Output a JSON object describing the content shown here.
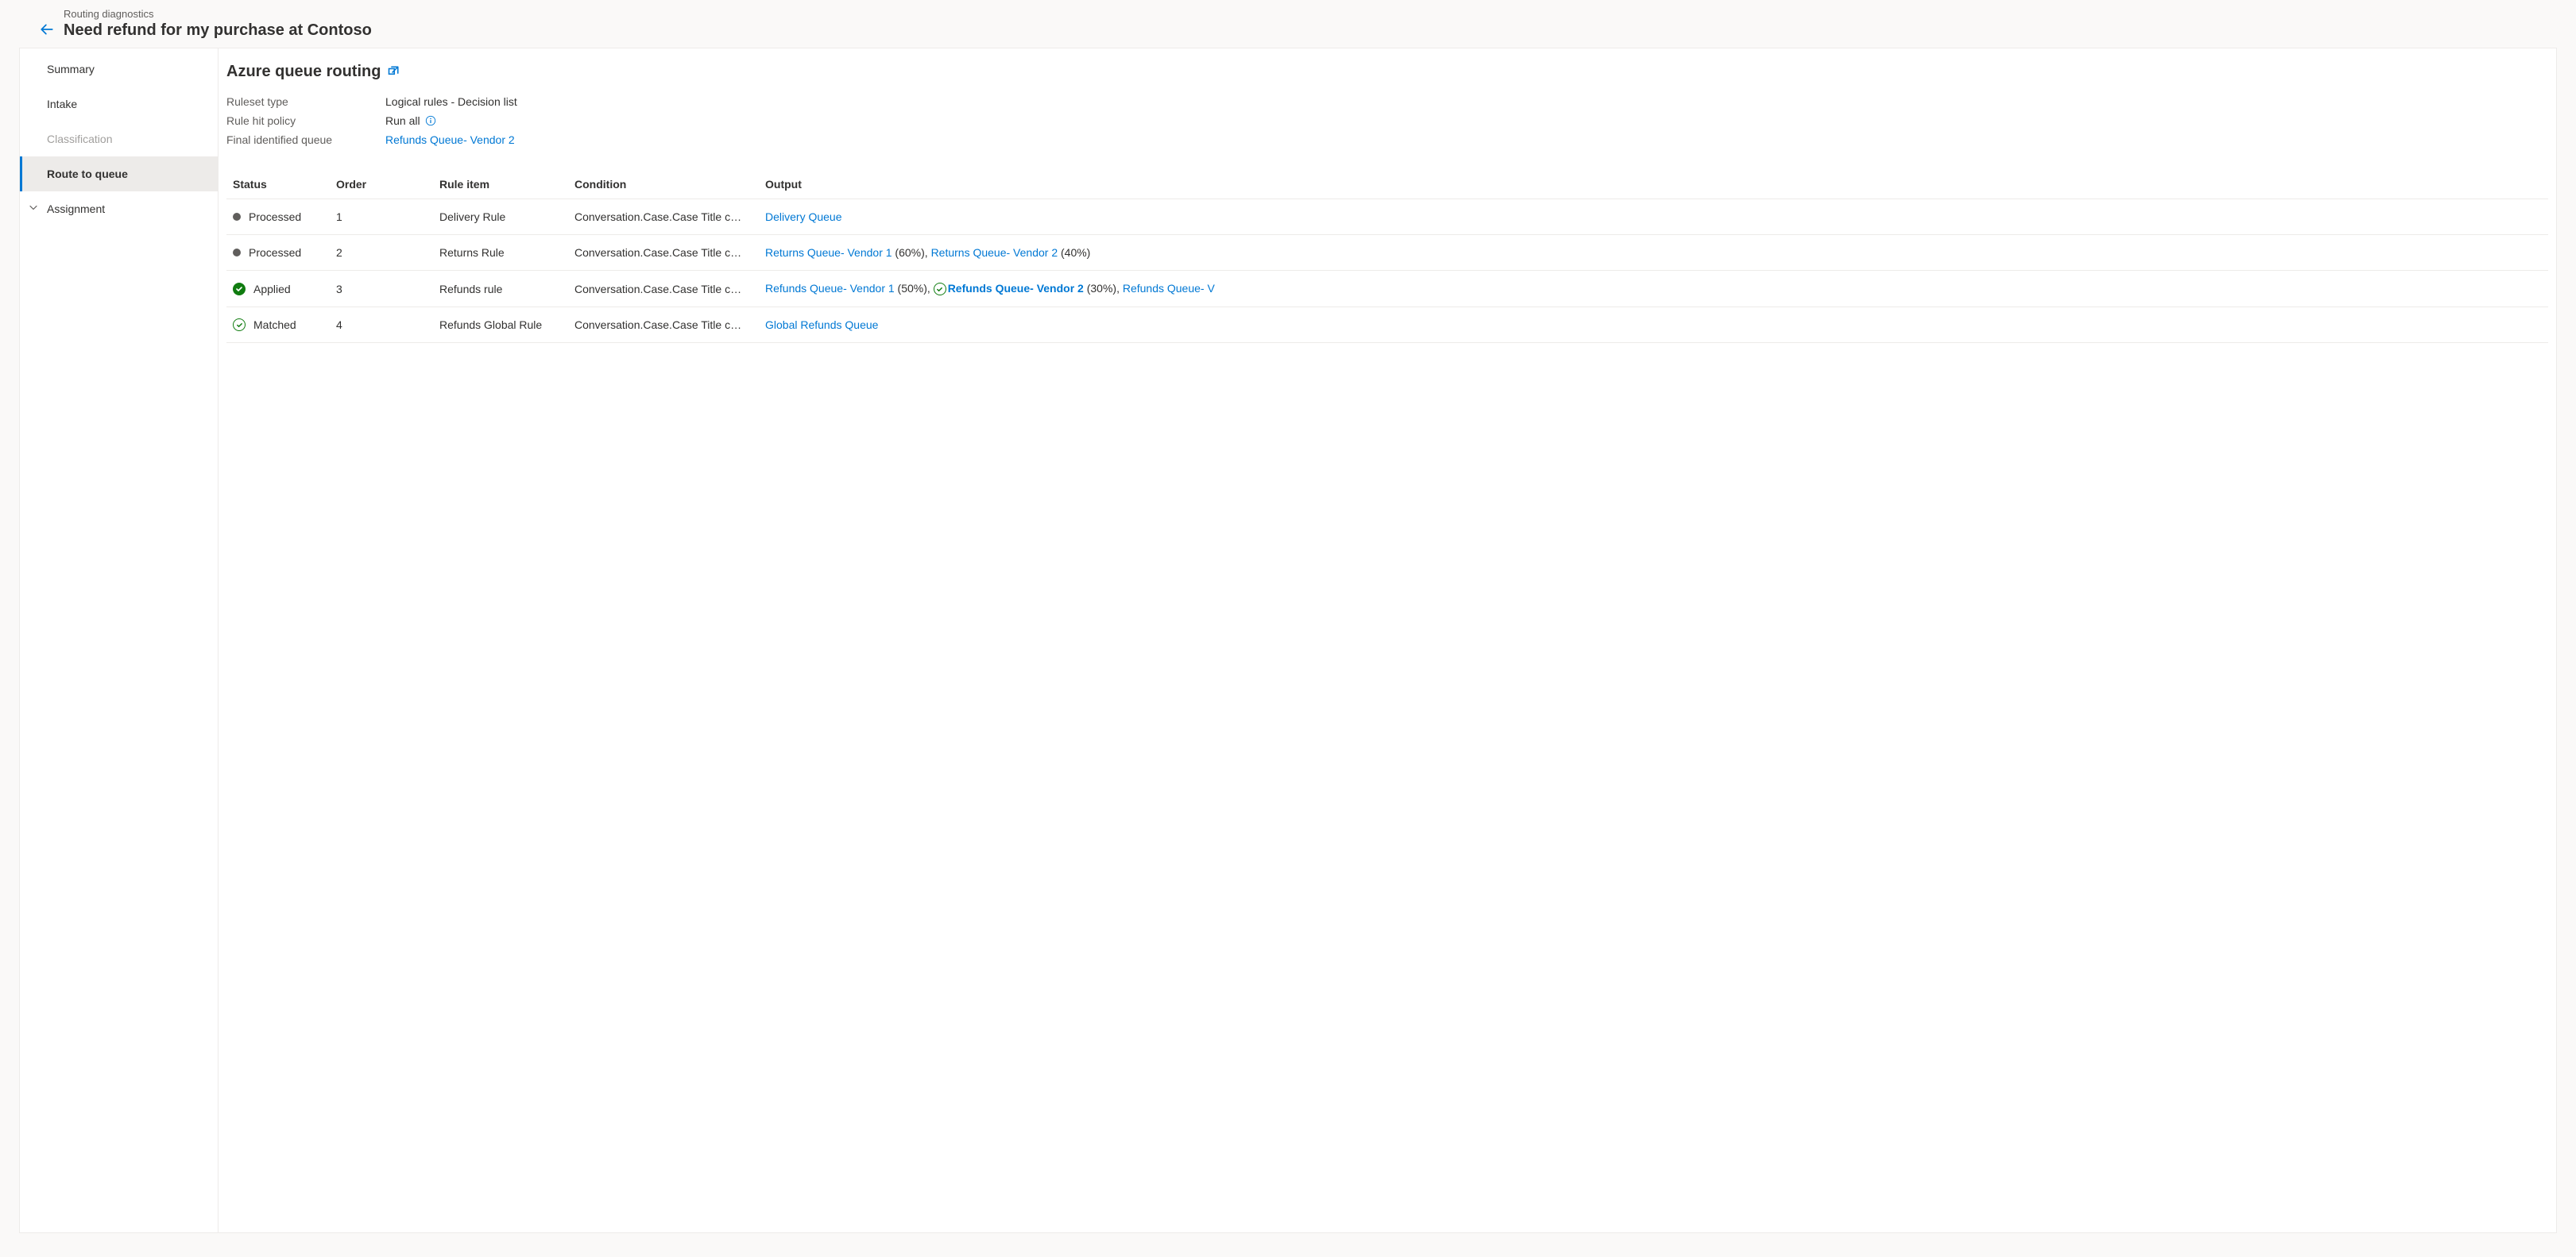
{
  "header": {
    "breadcrumb": "Routing diagnostics",
    "title": "Need refund for my purchase at Contoso"
  },
  "sidebar": {
    "items": [
      {
        "label": "Summary",
        "state": "normal"
      },
      {
        "label": "Intake",
        "state": "normal"
      },
      {
        "label": "Classification",
        "state": "disabled"
      },
      {
        "label": "Route to queue",
        "state": "selected"
      },
      {
        "label": "Assignment",
        "state": "expandable"
      }
    ]
  },
  "main": {
    "title": "Azure queue routing",
    "meta": {
      "ruleset_type_label": "Ruleset type",
      "ruleset_type_value": "Logical rules - Decision list",
      "rule_hit_label": "Rule hit policy",
      "rule_hit_value": "Run all",
      "final_queue_label": "Final identified queue",
      "final_queue_value": "Refunds Queue- Vendor 2"
    },
    "table": {
      "headers": {
        "status": "Status",
        "order": "Order",
        "rule_item": "Rule item",
        "condition": "Condition",
        "output": "Output"
      },
      "rows": [
        {
          "status_icon": "dot",
          "status": "Processed",
          "order": "1",
          "rule_item": "Delivery Rule",
          "condition": "Conversation.Case.Case Title c…",
          "outputs": [
            {
              "text": "Delivery Queue",
              "link": true
            }
          ]
        },
        {
          "status_icon": "dot",
          "status": "Processed",
          "order": "2",
          "rule_item": "Returns Rule",
          "condition": "Conversation.Case.Case Title c…",
          "outputs": [
            {
              "text": "Returns Queue- Vendor 1",
              "link": true,
              "suffix": " (60%), "
            },
            {
              "text": "Returns Queue- Vendor 2",
              "link": true,
              "suffix": " (40%)"
            }
          ]
        },
        {
          "status_icon": "check-solid",
          "status": "Applied",
          "order": "3",
          "rule_item": "Refunds rule",
          "condition": "Conversation.Case.Case Title c…",
          "outputs": [
            {
              "text": "Refunds Queue- Vendor 1",
              "link": true,
              "suffix": " (50%), "
            },
            {
              "text": "Refunds Queue- Vendor 2",
              "link": true,
              "bold": true,
              "icon": "check-outline",
              "suffix": " (30%), "
            },
            {
              "text": "Refunds Queue- V",
              "link": true
            }
          ]
        },
        {
          "status_icon": "check-outline",
          "status": "Matched",
          "order": "4",
          "rule_item": "Refunds Global Rule",
          "condition": "Conversation.Case.Case Title c…",
          "outputs": [
            {
              "text": "Global Refunds Queue",
              "link": true
            }
          ]
        }
      ]
    }
  }
}
